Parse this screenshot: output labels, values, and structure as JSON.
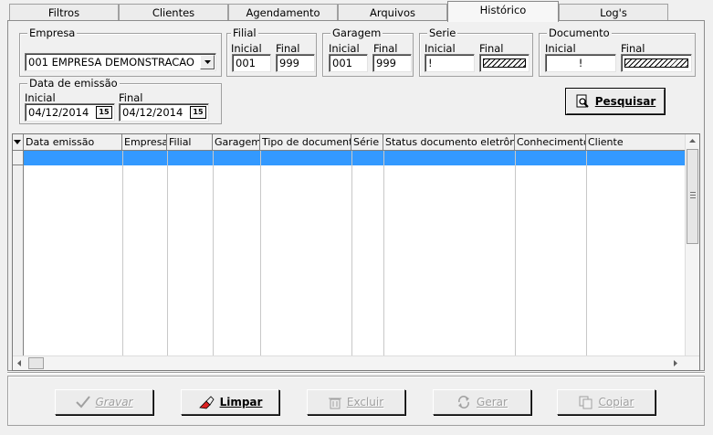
{
  "tabs": [
    {
      "label": "Filtros"
    },
    {
      "label": "Clientes"
    },
    {
      "label": "Agendamento"
    },
    {
      "label": "Arquivos"
    },
    {
      "label": "Histórico"
    },
    {
      "label": "Log's"
    }
  ],
  "active_tab": "Histórico",
  "empresa": {
    "title": "Empresa",
    "value": "001 EMPRESA DEMONSTRACAO"
  },
  "filial": {
    "title": "Filial",
    "inicial_label": "Inicial",
    "final_label": "Final",
    "inicial": "001",
    "final": "999"
  },
  "garagem": {
    "title": "Garagem",
    "inicial_label": "Inicial",
    "final_label": "Final",
    "inicial": "001",
    "final": "999"
  },
  "serie": {
    "title": "Serie",
    "inicial_label": "Inicial",
    "final_label": "Final",
    "inicial": "!"
  },
  "documento": {
    "title": "Documento",
    "inicial_label": "Inicial",
    "final_label": "Final",
    "inicial": "!"
  },
  "data_emissao": {
    "title": "Data de emissão",
    "inicial_label": "Inicial",
    "final_label": "Final",
    "inicial": "04/12/2014",
    "final": "04/12/2014",
    "cal_icon": "15"
  },
  "pesquisar": {
    "label": "Pesquisar"
  },
  "grid": {
    "columns": [
      "Data emissão",
      "Empresa",
      "Filial",
      "Garagem",
      "Tipo de documento",
      "Série",
      "Status documento eletrônico",
      "Conhecimento",
      "Cliente"
    ]
  },
  "actions": [
    {
      "label": "Gravar",
      "icon": "check-icon",
      "enabled": false
    },
    {
      "label": "Limpar",
      "icon": "eraser-icon",
      "enabled": true
    },
    {
      "label": "Excluir",
      "icon": "trash-icon",
      "enabled": false
    },
    {
      "label": "Gerar",
      "icon": "refresh-icon",
      "enabled": false
    },
    {
      "label": "Copiar",
      "icon": "copy-icon",
      "enabled": false
    }
  ],
  "colors": {
    "selection": "#3399ff",
    "window": "#f0f0f0"
  }
}
